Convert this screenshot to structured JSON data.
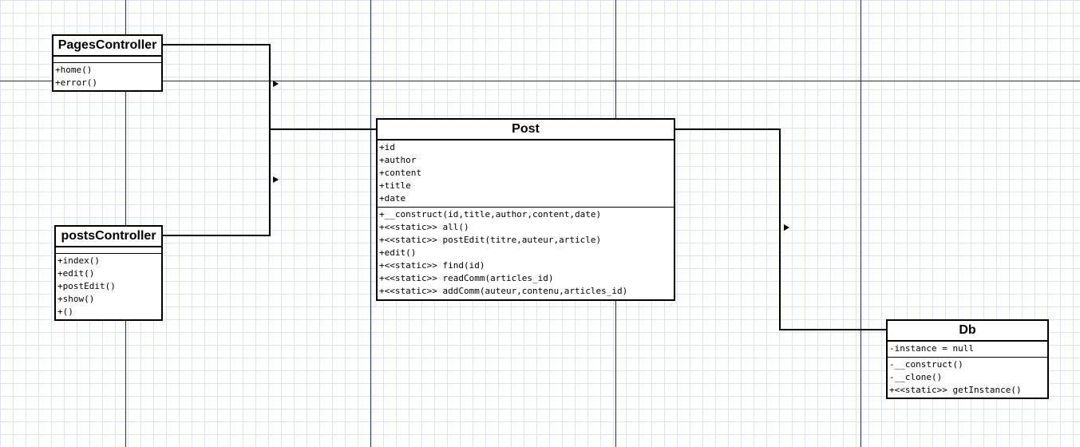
{
  "classes": {
    "pages_controller": {
      "name": "PagesController",
      "attributes": [],
      "methods": [
        "+home()",
        "+error()"
      ]
    },
    "posts_controller": {
      "name": "postsController",
      "attributes": [],
      "methods": [
        "+index()",
        "+edit()",
        "+postEdit()",
        "+show()",
        "+()"
      ]
    },
    "post": {
      "name": "Post",
      "attributes": [
        "+id",
        "+author",
        "+content",
        "+title",
        "+date"
      ],
      "methods": [
        "+__construct(id,title,author,content,date)",
        "+<<static>> all()",
        "+<<static>> postEdit(titre,auteur,article)",
        "+edit()",
        "+<<static>> find(id)",
        "+<<static>> readComm(articles_id)",
        "+<<static>> addComm(auteur,contenu,articles_id)"
      ]
    },
    "db": {
      "name": "Db",
      "attributes": [
        "-instance = null"
      ],
      "methods": [
        "-__construct()",
        "-__clone()",
        "+<<static>> getInstance()"
      ]
    }
  },
  "colors": {
    "guide_line": "#1c2a8c",
    "grid": "#dfe3ea",
    "connector": "#000000"
  }
}
